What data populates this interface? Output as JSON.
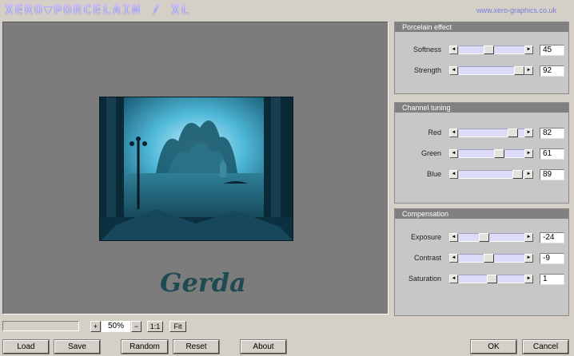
{
  "header": {
    "logo_text": "XERO▼PORCELAIN / XL",
    "site_url": "www.xero-graphics.co.uk"
  },
  "preview": {
    "signature": "Gerda"
  },
  "panels": [
    {
      "title": "Porcelain effect",
      "sliders": [
        {
          "label": "Softness",
          "value": "45",
          "fraction": 0.45
        },
        {
          "label": "Strength",
          "value": "92",
          "fraction": 0.92
        }
      ]
    },
    {
      "title": "Channel tuning",
      "sliders": [
        {
          "label": "Red",
          "value": "82",
          "fraction": 0.82
        },
        {
          "label": "Green",
          "value": "61",
          "fraction": 0.61
        },
        {
          "label": "Blue",
          "value": "89",
          "fraction": 0.89
        }
      ]
    },
    {
      "title": "Compensation",
      "sliders": [
        {
          "label": "Exposure",
          "value": "-24",
          "fraction": 0.38
        },
        {
          "label": "Contrast",
          "value": "-9",
          "fraction": 0.45
        },
        {
          "label": "Saturation",
          "value": "1",
          "fraction": 0.5
        }
      ]
    }
  ],
  "zoom": {
    "plus_label": "+",
    "value": "50%",
    "minus_label": "−",
    "one_to_one_label": "1:1",
    "fit_label": "Fit"
  },
  "buttons": {
    "load": "Load",
    "save": "Save",
    "random": "Random",
    "reset": "Reset",
    "about": "About",
    "ok": "OK",
    "cancel": "Cancel"
  },
  "arrows": {
    "left": "◄",
    "right": "►"
  },
  "colors": {
    "slider_track": "#dcdcf8",
    "panel_header": "#808080",
    "preview_bg": "#7c7c7c",
    "url_text": "#7b7bd8",
    "signature": "#1e4a52"
  }
}
